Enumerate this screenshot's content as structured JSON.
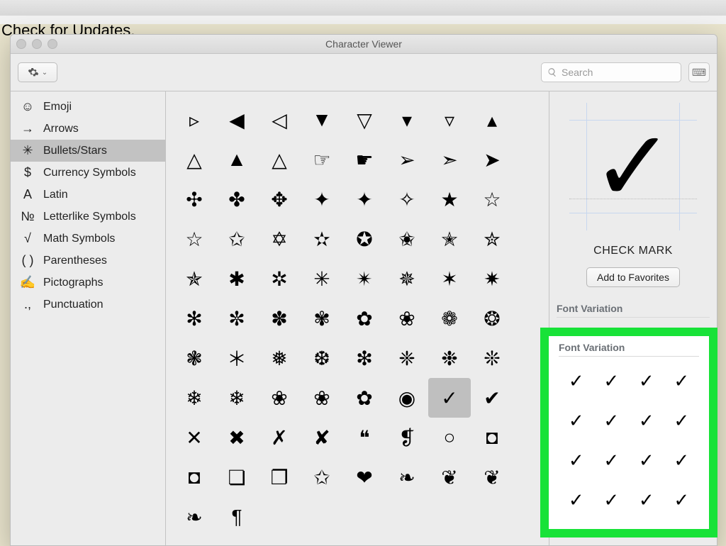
{
  "background_text": "Check for Updates.",
  "window": {
    "title": "Character Viewer",
    "search_placeholder": "Search",
    "gear_label": "Actions"
  },
  "sidebar": {
    "items": [
      {
        "icon": "☺",
        "label": "Emoji"
      },
      {
        "icon": "→",
        "label": "Arrows"
      },
      {
        "icon": "✳",
        "label": "Bullets/Stars"
      },
      {
        "icon": "$",
        "label": "Currency Symbols"
      },
      {
        "icon": "A",
        "label": "Latin"
      },
      {
        "icon": "№",
        "label": "Letterlike Symbols"
      },
      {
        "icon": "√",
        "label": "Math Symbols"
      },
      {
        "icon": "( )",
        "label": "Parentheses"
      },
      {
        "icon": "✍",
        "label": "Pictographs"
      },
      {
        "icon": ".,",
        "label": "Punctuation"
      }
    ],
    "selected_index": 2
  },
  "grid": {
    "selected_index": 62,
    "chars": [
      "▹",
      "◀",
      "◁",
      "▼",
      "▽",
      "▾",
      "▿",
      "▴",
      "△",
      "▲",
      "△",
      "☞",
      "☛",
      "➢",
      "➣",
      "➤",
      "✣",
      "✤",
      "✥",
      "✦",
      "✦",
      "✧",
      "★",
      "☆",
      "☆",
      "✩",
      "✡",
      "✫",
      "✪",
      "✬",
      "✭",
      "✮",
      "✯",
      "✱",
      "✲",
      "✳",
      "✴",
      "✵",
      "✶",
      "✷",
      "✻",
      "✼",
      "✽",
      "✾",
      "✿",
      "❀",
      "❁",
      "❂",
      "❃",
      "＊",
      "❅",
      "❆",
      "❇",
      "❈",
      "❉",
      "❊",
      "❄",
      "❄",
      "❀",
      "❀",
      "✿",
      "◉",
      "✓",
      "✔",
      "✕",
      "✖",
      "✗",
      "✘",
      "❝",
      "❡",
      "○",
      "◘",
      "◘",
      "❏",
      "❐",
      "✩",
      "❤",
      "❧",
      "❦",
      "❦",
      "❧",
      "¶"
    ]
  },
  "detail": {
    "glyph": "✓",
    "name": "CHECK MARK",
    "favorites_label": "Add to Favorites",
    "variation_heading": "Font Variation",
    "variations": [
      "✓",
      "✓",
      "✓",
      "✓",
      "✓",
      "✓",
      "✓",
      "✓",
      "✓",
      "✓",
      "✓",
      "✓",
      "✓",
      "✓",
      "✓",
      "✓"
    ]
  }
}
